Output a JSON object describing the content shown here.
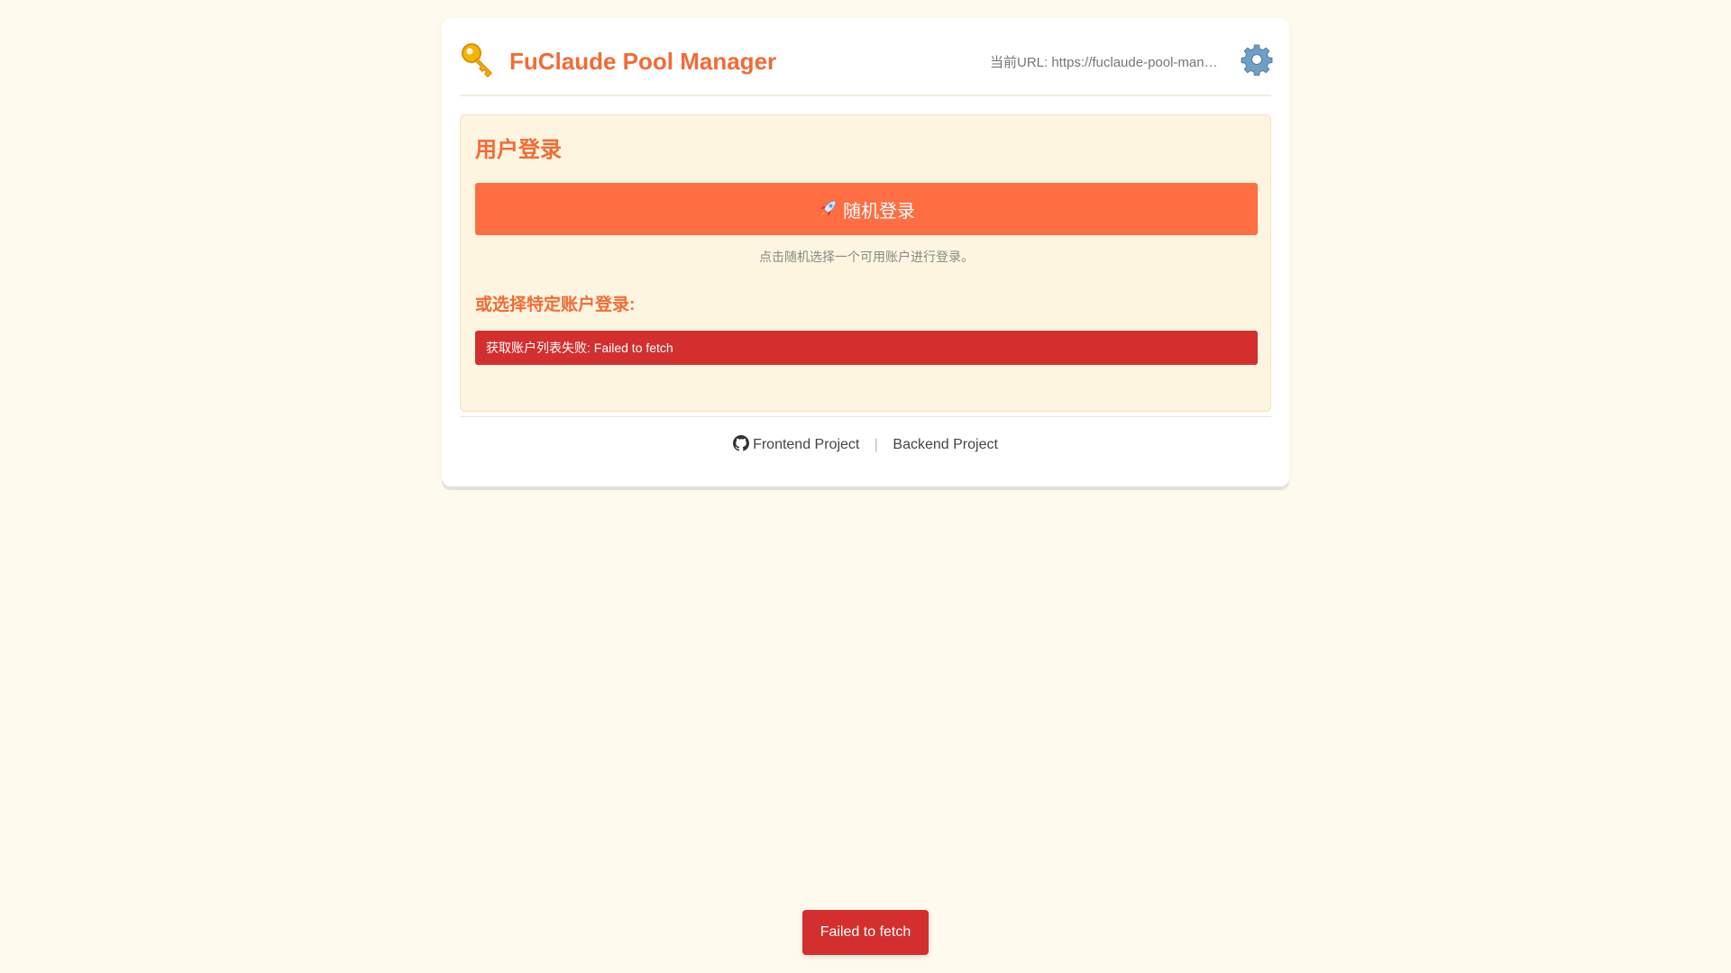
{
  "header": {
    "title": "FuClaude Pool Manager",
    "logo_icon": "key-icon",
    "url_text": "当前URL: https://fuclaude-pool-manager",
    "settings_icon": "gear-icon"
  },
  "login": {
    "title": "用户登录",
    "random_button_label": "随机登录",
    "random_button_icon": "rocket-icon",
    "hint": "点击随机选择一个可用账户进行登录。",
    "subtitle": "或选择特定账户登录:",
    "error_message": "获取账户列表失败: Failed to fetch"
  },
  "footer": {
    "frontend_label": "Frontend Project",
    "separator": "|",
    "backend_label": "Backend Project",
    "github_icon": "github-icon"
  },
  "toast": {
    "message": "Failed to fetch"
  },
  "colors": {
    "background": "#fffaee",
    "accent": "#f26b35",
    "button": "#ff6d42",
    "error": "#d32f2f",
    "panel": "#fdf5e0"
  }
}
